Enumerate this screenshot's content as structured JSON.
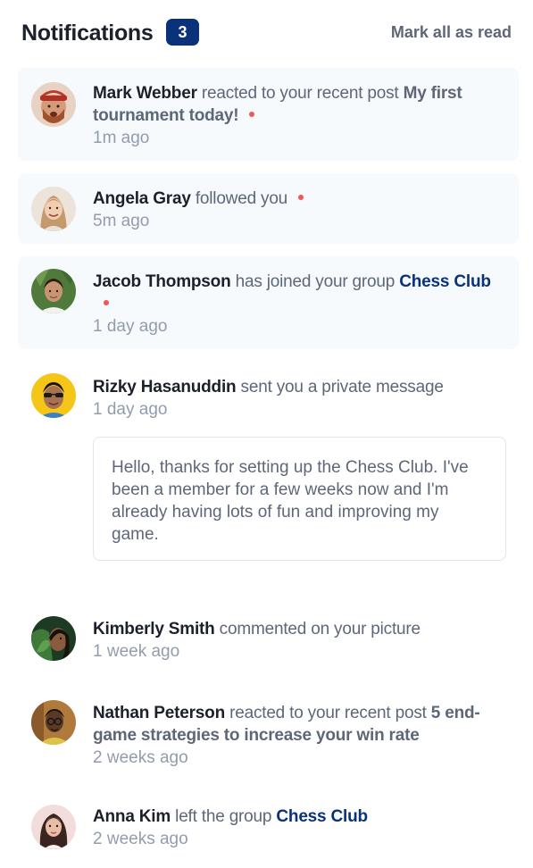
{
  "header": {
    "title": "Notifications",
    "unread_count": "3",
    "mark_all_label": "Mark all as read"
  },
  "notifications": [
    {
      "name": "Mark Webber",
      "action": "reacted to your recent post",
      "post": "My first tournament today!",
      "time": "1m ago",
      "unread": true,
      "avatar_icon": "avatar-mark-webber"
    },
    {
      "name": "Angela Gray",
      "action": "followed you",
      "time": "5m ago",
      "unread": true,
      "avatar_icon": "avatar-angela-gray"
    },
    {
      "name": "Jacob Thompson",
      "action": "has joined your group",
      "group": "Chess Club",
      "time": "1 day ago",
      "unread": true,
      "avatar_icon": "avatar-jacob-thompson"
    },
    {
      "name": "Rizky Hasanuddin",
      "action": "sent you a private message",
      "time": "1 day ago",
      "message": "Hello, thanks for setting up the Chess Club. I've been a member for a few weeks now and I'm already having lots of fun and improving my game.",
      "unread": false,
      "avatar_icon": "avatar-rizky-hasanuddin"
    },
    {
      "name": "Kimberly Smith",
      "action": "commented on your picture",
      "time": "1 week ago",
      "unread": false,
      "avatar_icon": "avatar-kimberly-smith"
    },
    {
      "name": "Nathan Peterson",
      "action": "reacted to your recent post",
      "post": "5 end-game strategies to increase your win rate",
      "time": "2 weeks ago",
      "unread": false,
      "avatar_icon": "avatar-nathan-peterson"
    },
    {
      "name": "Anna Kim",
      "action": "left the group",
      "group": "Chess Club",
      "time": "2 weeks ago",
      "unread": false,
      "avatar_icon": "avatar-anna-kim"
    }
  ],
  "colors": {
    "unread_bg": "#f7fafd",
    "badge_bg": "#0a327b",
    "dot": "#f65552",
    "name": "#1c202b",
    "group": "#0a327b",
    "muted": "#939cad"
  }
}
